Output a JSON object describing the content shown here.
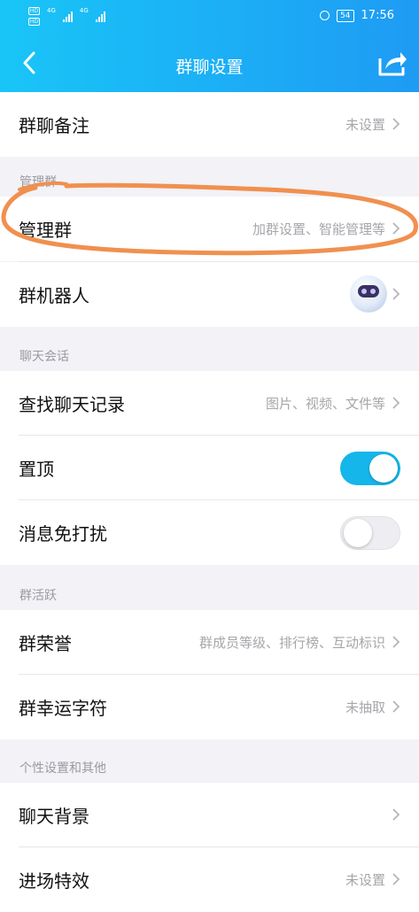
{
  "status_bar": {
    "sim1": "HD",
    "sim2": "HD",
    "net1": "4G",
    "net2": "4G",
    "battery": "54",
    "time": "17:56"
  },
  "nav": {
    "title": "群聊设置",
    "back_icon": "chevron-left-icon",
    "share_icon": "share-icon"
  },
  "rows": {
    "remark": {
      "label": "群聊备注",
      "value": "未设置"
    },
    "manage": {
      "label": "管理群",
      "value": "加群设置、智能管理等"
    },
    "robot": {
      "label": "群机器人"
    },
    "search": {
      "label": "查找聊天记录",
      "value": "图片、视频、文件等"
    },
    "pin": {
      "label": "置顶",
      "toggle": true
    },
    "mute": {
      "label": "消息免打扰",
      "toggle": false
    },
    "honor": {
      "label": "群荣誉",
      "value": "群成员等级、排行榜、互动标识"
    },
    "lucky": {
      "label": "群幸运字符",
      "value": "未抽取"
    },
    "bg": {
      "label": "聊天背景"
    },
    "entry": {
      "label": "进场特效",
      "value": "未设置"
    }
  },
  "sections": {
    "manage": "管理群",
    "chat": "聊天会话",
    "active": "群活跃",
    "personal": "个性设置和其他"
  },
  "colors": {
    "header_start": "#19c5f7",
    "header_end": "#1e9bf4",
    "toggle_on": "#15b6ea",
    "annotation": "#f0904f"
  }
}
